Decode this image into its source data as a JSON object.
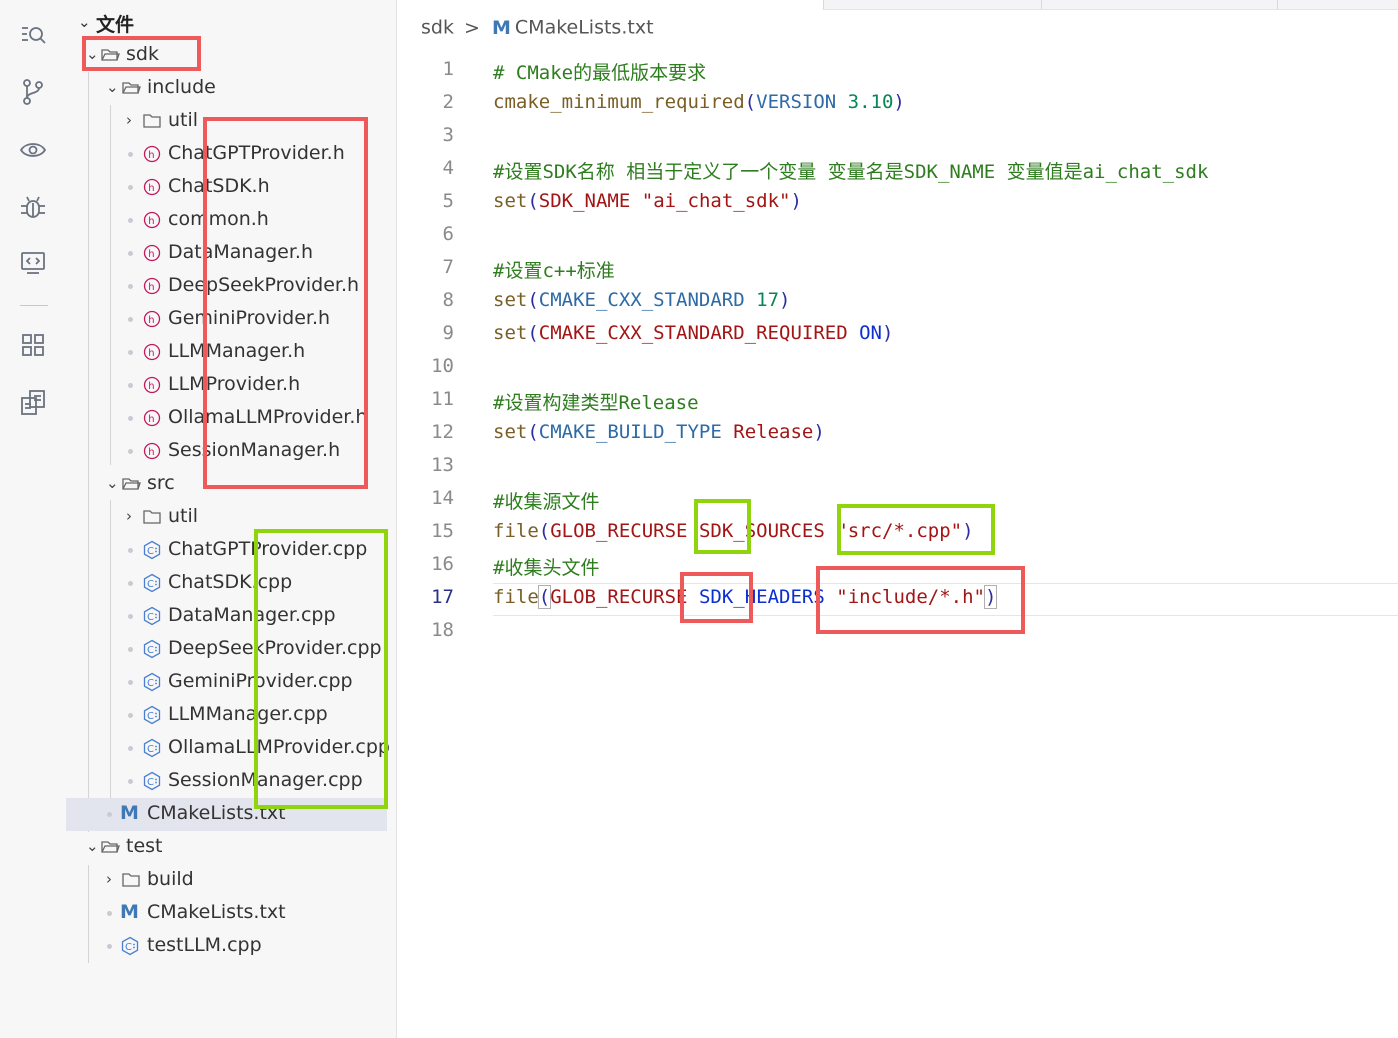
{
  "activity_bar": {
    "icons": [
      "search-list-icon",
      "source-control-icon",
      "eye-icon",
      "debug-bug-icon",
      "remote-screen-icon",
      "extensions-grid-icon",
      "document-list-icon"
    ]
  },
  "explorer": {
    "title": "文件",
    "tree": {
      "sdk": "sdk",
      "include": "include",
      "include_util": "util",
      "headers": [
        "ChatGPTProvider.h",
        "ChatSDK.h",
        "common.h",
        "DataManager.h",
        "DeepSeekProvider.h",
        "GeminiProvider.h",
        "LLMManager.h",
        "LLMProvider.h",
        "OllamaLLMProvider.h",
        "SessionManager.h"
      ],
      "header_icon_letter": "h",
      "src": "src",
      "src_util": "util",
      "sources": [
        "ChatGPTProvider.cpp",
        "ChatSDK.cpp",
        "DataManager.cpp",
        "DeepSeekProvider.cpp",
        "GeminiProvider.cpp",
        "LLMManager.cpp",
        "OllamaLLMProvider.cpp",
        "SessionManager.cpp"
      ],
      "sdk_cmake": "CMakeLists.txt",
      "test": "test",
      "build": "build",
      "test_cmake": "CMakeLists.txt",
      "test_cpp": "testLLM.cpp",
      "cmake_icon_letter": "M"
    }
  },
  "editor": {
    "breadcrumb": {
      "folder": "sdk",
      "separator": ">",
      "icon_letter": "M",
      "file": "CMakeLists.txt"
    },
    "active_line": 17,
    "line_numbers": [
      "1",
      "2",
      "3",
      "4",
      "5",
      "6",
      "7",
      "8",
      "9",
      "10",
      "11",
      "12",
      "13",
      "14",
      "15",
      "16",
      "17",
      "18"
    ],
    "code": {
      "l1": "# CMake的最低版本要求",
      "l2_fn": "cmake_minimum_required",
      "l2_kw": "VERSION",
      "l2_num": "3.10",
      "l4": "#设置SDK名称 相当于定义了一个变量 变量名是SDK_NAME 变量值是ai_chat_sdk",
      "l5_fn": "set",
      "l5_var": "SDK_NAME",
      "l5_str": "\"ai_chat_sdk\"",
      "l7": "#设置c++标准",
      "l8_fn": "set",
      "l8_kw": "CMAKE_CXX_STANDARD",
      "l8_num": "17",
      "l9_fn": "set",
      "l9_var": "CMAKE_CXX_STANDARD_REQUIRED",
      "l9_kw": "ON",
      "l11": "#设置构建类型Release",
      "l12_fn": "set",
      "l12_kw": "CMAKE_BUILD_TYPE",
      "l12_var": "Release",
      "l14": "#收集源文件",
      "l15_fn": "file",
      "l15_kw": "GLOB_RECURSE",
      "l15_var": "SDK_SOURCES",
      "l15_str": "\"src/*.cpp\"",
      "l16": "#收集头文件",
      "l17_fn": "file",
      "l17_kw": "GLOB_RECURSE",
      "l17_var": "SDK_HEADERS",
      "l17_str": "\"include/*.h\""
    }
  },
  "annotation_colors": {
    "red": "#ee5a5a",
    "green": "#8fd40d"
  },
  "syntax_colors": {
    "comment": "#2e7d1e",
    "function": "#795e26",
    "keyword": "#2d6aa6",
    "string": "#a31515",
    "number": "#098658"
  }
}
